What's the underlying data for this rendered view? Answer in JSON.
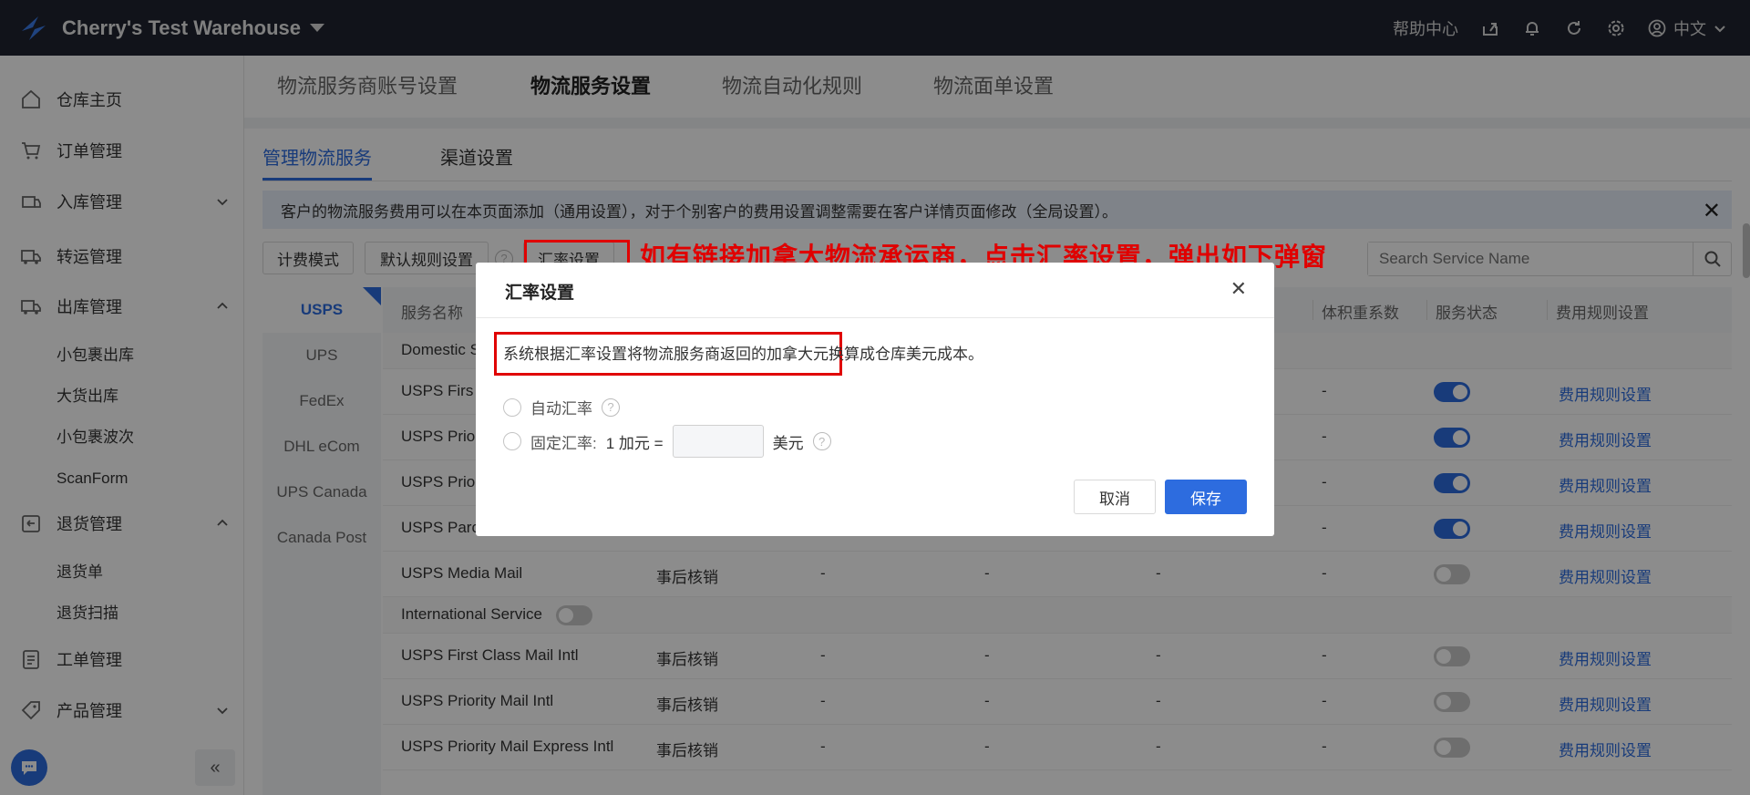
{
  "topbar": {
    "warehouse": "Cherry's Test Warehouse",
    "help": "帮助中心",
    "lang": "中文",
    "icons": [
      "export-icon",
      "bell-icon",
      "refresh-icon",
      "settings-icon",
      "user-icon"
    ]
  },
  "sidebar": {
    "items": [
      {
        "label": "仓库主页",
        "icon": "home-icon"
      },
      {
        "label": "订单管理",
        "icon": "cart-icon"
      },
      {
        "label": "入库管理",
        "icon": "inbound-icon"
      },
      {
        "label": "转运管理",
        "icon": "truck-icon"
      },
      {
        "label": "出库管理",
        "icon": "outbound-icon"
      },
      {
        "label": "退货管理",
        "icon": "return-icon"
      },
      {
        "label": "工单管理",
        "icon": "ticket-icon"
      },
      {
        "label": "产品管理",
        "icon": "tag-icon"
      }
    ],
    "outbound_sub": [
      "小包裹出库",
      "大货出库",
      "小包裹波次",
      "ScanForm"
    ],
    "return_sub": [
      "退货单",
      "退货扫描"
    ],
    "collapse": "«"
  },
  "tabs1": [
    "物流服务商账号设置",
    "物流服务设置",
    "物流自动化规则",
    "物流面单设置"
  ],
  "tabs2": [
    "管理物流服务",
    "渠道设置"
  ],
  "notice": "客户的物流服务费用可以在本页面添加（通用设置），对于个别客户的费用设置调整需要在客户详情页面修改（全局设置）。",
  "toolbar": {
    "billing_mode": "计费模式",
    "default_rules": "默认规则设置",
    "exchange_rate": "汇率设置",
    "search_placeholder": "Search Service Name"
  },
  "carriers": [
    "USPS",
    "UPS",
    "FedEx",
    "DHL eCom",
    "UPS Canada",
    "Canada Post"
  ],
  "table": {
    "headers": {
      "service_name": "服务名称",
      "volume_factor": "体积重系数",
      "status": "服务状态",
      "fee_rules": "费用规则设置"
    },
    "domestic_group": "Domestic S",
    "international_group": "International Service",
    "rows_partial": [
      {
        "name": "USPS Firs",
        "volume": "-",
        "link": "费用规则设置"
      },
      {
        "name": "USPS Prio",
        "volume": "-",
        "link": "费用规则设置"
      },
      {
        "name": "USPS Prio",
        "volume": "-",
        "link": "费用规则设置"
      },
      {
        "name": "USPS Parc",
        "volume": "-",
        "link": "费用规则设置"
      }
    ],
    "rows_full": [
      {
        "name": "USPS Media Mail",
        "billing": "事后核销",
        "c3": "-",
        "c4": "-",
        "c5": "-",
        "c6": "-",
        "link": "费用规则设置"
      },
      {
        "name": "USPS First Class Mail Intl",
        "billing": "事后核销",
        "c3": "-",
        "c4": "-",
        "c5": "-",
        "c6": "-",
        "link": "费用规则设置"
      },
      {
        "name": "USPS Priority Mail Intl",
        "billing": "事后核销",
        "c3": "-",
        "c4": "-",
        "c5": "-",
        "c6": "-",
        "link": "费用规则设置"
      },
      {
        "name": "USPS Priority Mail Express Intl",
        "billing": "事后核销",
        "c3": "-",
        "c4": "-",
        "c5": "-",
        "c6": "-",
        "link": "费用规则设置"
      }
    ]
  },
  "modal": {
    "title": "汇率设置",
    "description": "系统根据汇率设置将物流服务商返回的加拿大元换算成仓库美元成本。",
    "auto_rate": "自动汇率",
    "fixed_rate": "固定汇率:",
    "fixed_prefix": "1 加元 =",
    "fixed_unit": "美元",
    "cancel": "取消",
    "save": "保存"
  },
  "annotation": "如有链接加拿大物流承运商，点击汇率设置，弹出如下弹窗",
  "colors": {
    "accent": "#2d6cdf",
    "annotation": "#e00000",
    "topbar": "#1f2430"
  }
}
